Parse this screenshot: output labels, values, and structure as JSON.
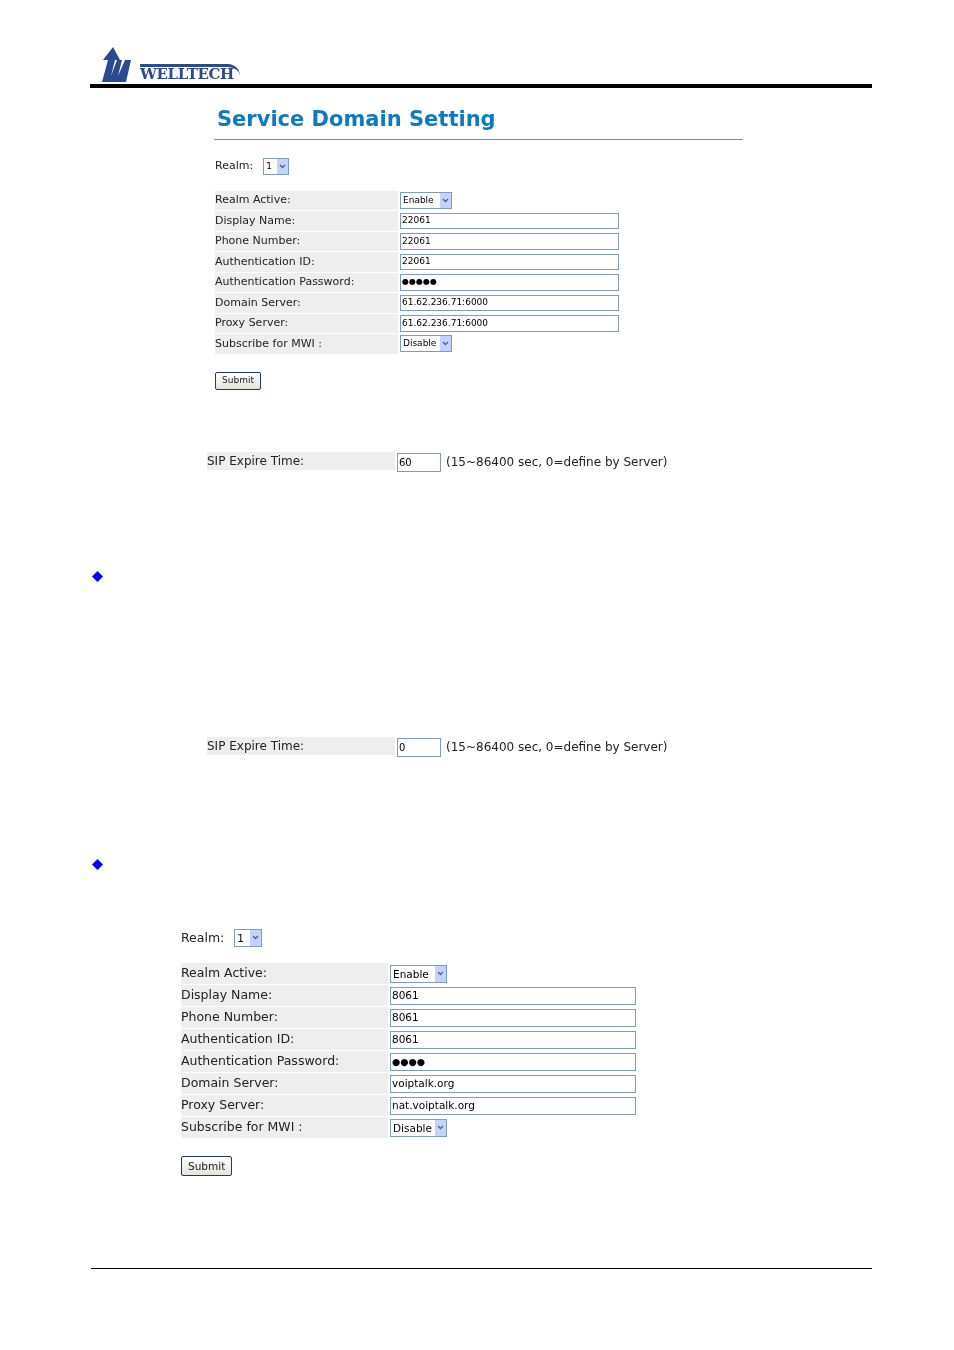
{
  "logo": {
    "text": "WELLTECH"
  },
  "title": "Service Domain Setting",
  "blocks": [
    {
      "kind": "realm_form",
      "realm_label": "Realm:",
      "realm": "1",
      "submit": "Submit",
      "rows": [
        {
          "kind": "select",
          "label": "Realm Active:",
          "value": "Enable"
        },
        {
          "kind": "text",
          "label": "Display Name:",
          "value": "22061"
        },
        {
          "kind": "text",
          "label": "Phone Number:",
          "value": "22061"
        },
        {
          "kind": "text",
          "label": "Authentication ID:",
          "value": "22061"
        },
        {
          "kind": "password",
          "label": "Authentication Password:",
          "value": "●●●●●"
        },
        {
          "kind": "text",
          "label": "Domain Server:",
          "value": "61.62.236.71:6000"
        },
        {
          "kind": "text",
          "label": "Proxy Server:",
          "value": "61.62.236.71:6000"
        },
        {
          "kind": "select",
          "label": "Subscribe for MWI :",
          "value": "Disable"
        }
      ]
    },
    {
      "kind": "sip_expire",
      "label": "SIP Expire Time:",
      "value": "60",
      "hint": "(15~86400 sec, 0=define by Server)"
    },
    {
      "kind": "bullet"
    },
    {
      "kind": "sip_expire",
      "label": "SIP Expire Time:",
      "value": "0",
      "hint": "(15~86400 sec, 0=define by Server)"
    },
    {
      "kind": "bullet"
    },
    {
      "kind": "realm_form",
      "realm_label": "Realm:",
      "realm": "1",
      "submit": "Submit",
      "rows": [
        {
          "kind": "select",
          "label": "Realm Active:",
          "value": "Enable"
        },
        {
          "kind": "text",
          "label": "Display Name:",
          "value": "8061"
        },
        {
          "kind": "text",
          "label": "Phone Number:",
          "value": "8061"
        },
        {
          "kind": "text",
          "label": "Authentication ID:",
          "value": "8061"
        },
        {
          "kind": "password",
          "label": "Authentication Password:",
          "value": "●●●●"
        },
        {
          "kind": "text",
          "label": "Domain Server:",
          "value": "voiptalk.org"
        },
        {
          "kind": "text",
          "label": "Proxy Server:",
          "value": "nat.voiptalk.org"
        },
        {
          "kind": "select",
          "label": "Subscribe for MWI :",
          "value": "Disable"
        }
      ]
    }
  ]
}
